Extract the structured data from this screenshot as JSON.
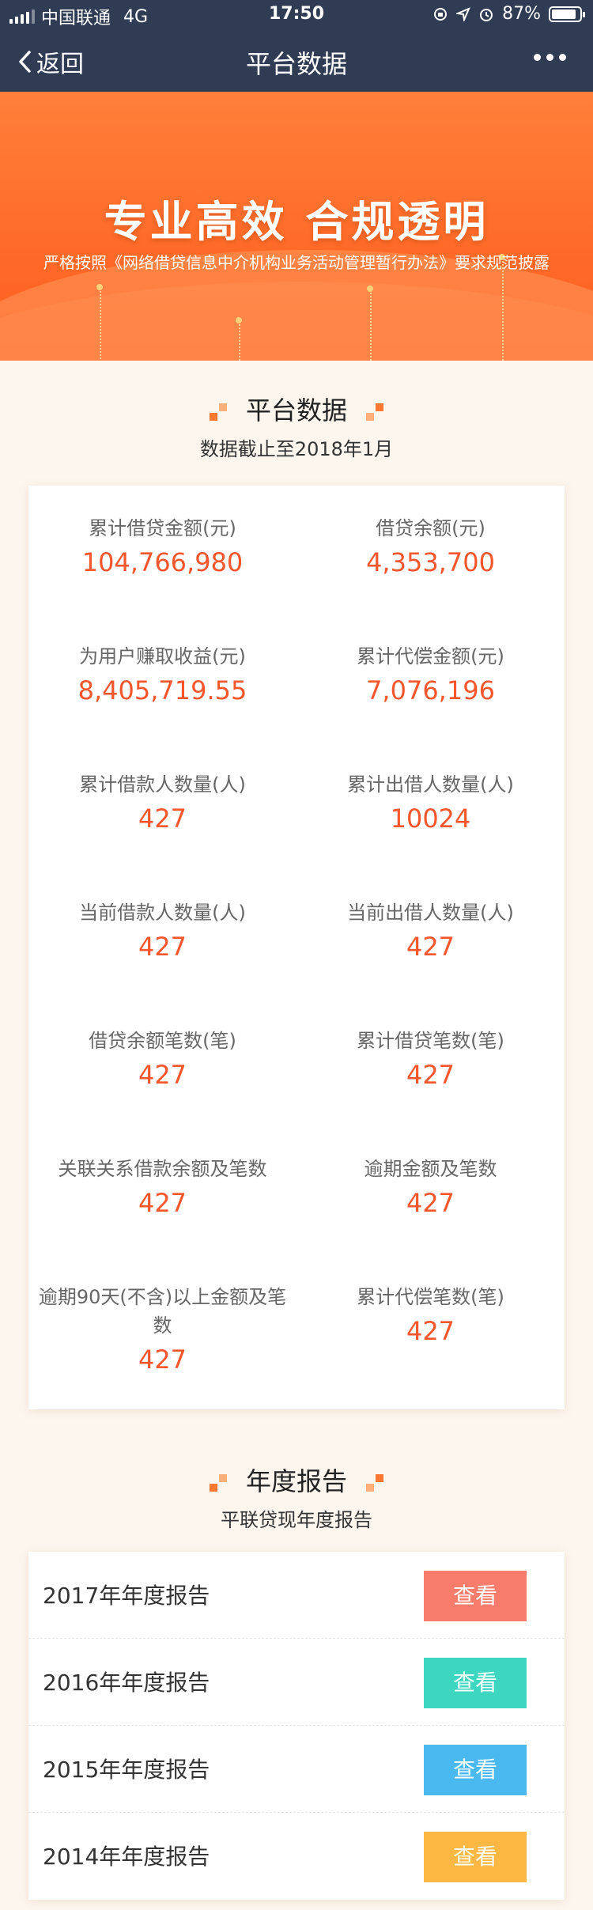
{
  "status_bar": {
    "carrier": "中国联通",
    "network": "4G",
    "time": "17:50",
    "battery": "87%",
    "battery_level": 0.87
  },
  "nav": {
    "back_label": "返回",
    "title": "平台数据"
  },
  "banner": {
    "slogan": "专业高效  合规透明",
    "subtitle": "严格按照《网络借贷信息中介机构业务活动管理暂行办法》要求规范披露"
  },
  "platform_section": {
    "title": "平台数据",
    "subtitle": "数据截止至2018年1月"
  },
  "stats": [
    {
      "label": "累计借贷金额(元)",
      "value": "104,766,980"
    },
    {
      "label": "借贷余额(元)",
      "value": "4,353,700"
    },
    {
      "label": "为用户赚取收益(元)",
      "value": "8,405,719.55"
    },
    {
      "label": "累计代偿金额(元)",
      "value": "7,076,196"
    },
    {
      "label": "累计借款人数量(人)",
      "value": "427"
    },
    {
      "label": "累计出借人数量(人)",
      "value": "10024"
    },
    {
      "label": "当前借款人数量(人)",
      "value": "427"
    },
    {
      "label": "当前出借人数量(人)",
      "value": "427"
    },
    {
      "label": "借贷余额笔数(笔)",
      "value": "427"
    },
    {
      "label": "累计借贷笔数(笔)",
      "value": "427"
    },
    {
      "label": "关联关系借款余额及笔数",
      "value": "427"
    },
    {
      "label": "逾期金额及笔数",
      "value": "427"
    },
    {
      "label": "逾期90天(不含)以上金额及笔数",
      "value": "427"
    },
    {
      "label": "累计代偿笔数(笔)",
      "value": "427"
    }
  ],
  "report_section": {
    "title": "年度报告",
    "subtitle": "平联贷现年度报告"
  },
  "reports": [
    {
      "name": "2017年年度报告",
      "button": "查看",
      "color": "#f77c6b"
    },
    {
      "name": "2016年年度报告",
      "button": "查看",
      "color": "#3dd6c0"
    },
    {
      "name": "2015年年度报告",
      "button": "查看",
      "color": "#4ab9ef"
    },
    {
      "name": "2014年年度报告",
      "button": "查看",
      "color": "#fdb843"
    }
  ]
}
